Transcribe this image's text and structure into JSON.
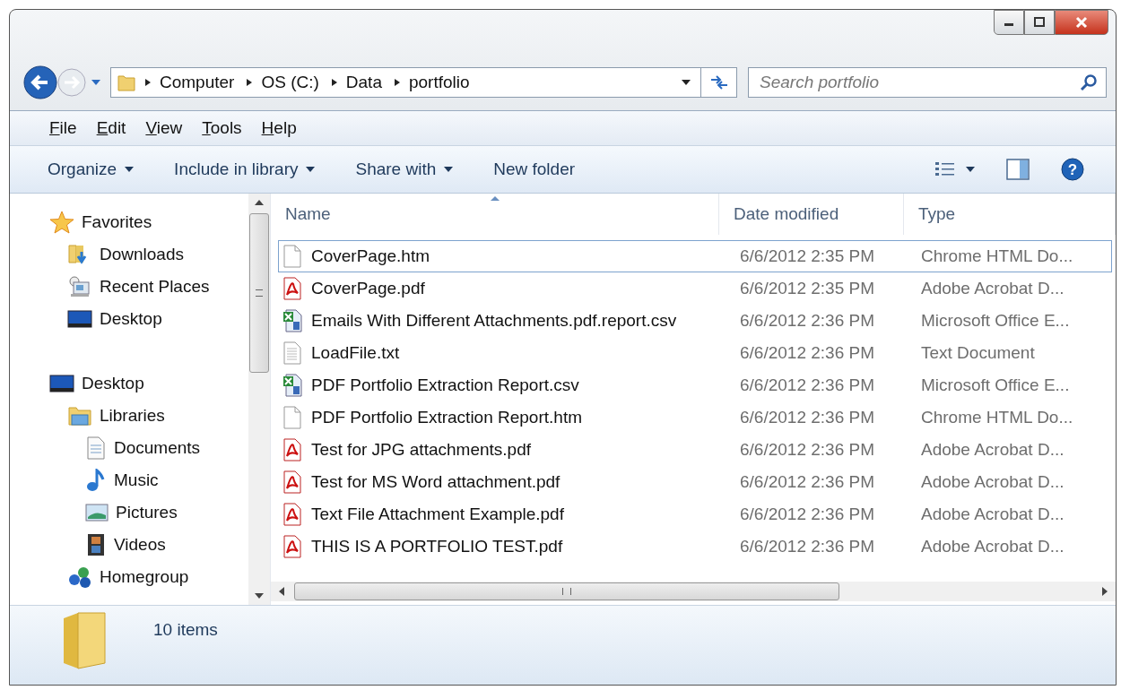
{
  "address_bar": {
    "crumbs": [
      "Computer",
      "OS (C:)",
      "Data",
      "portfolio"
    ]
  },
  "search": {
    "placeholder": "Search portfolio"
  },
  "menu_bar": [
    "File",
    "Edit",
    "View",
    "Tools",
    "Help"
  ],
  "command_bar": [
    {
      "label": "Organize",
      "dropdown": true
    },
    {
      "label": "Include in library",
      "dropdown": true
    },
    {
      "label": "Share with",
      "dropdown": true
    },
    {
      "label": "New folder",
      "dropdown": false
    }
  ],
  "sidebar": {
    "sections": [
      {
        "label": "Favorites",
        "kind": "star",
        "children": [
          {
            "label": "Downloads",
            "kind": "downloads"
          },
          {
            "label": "Recent Places",
            "kind": "recent"
          },
          {
            "label": "Desktop",
            "kind": "desktop"
          }
        ]
      },
      {
        "label": "Desktop",
        "kind": "desktop",
        "children": [
          {
            "label": "Libraries",
            "kind": "libraries",
            "children": [
              {
                "label": "Documents",
                "kind": "documents"
              },
              {
                "label": "Music",
                "kind": "music"
              },
              {
                "label": "Pictures",
                "kind": "pictures"
              },
              {
                "label": "Videos",
                "kind": "videos"
              }
            ]
          },
          {
            "label": "Homegroup",
            "kind": "homegroup"
          }
        ]
      }
    ]
  },
  "table": {
    "columns": [
      {
        "label": "Name",
        "sorted": true
      },
      {
        "label": "Date modified",
        "sorted": false
      },
      {
        "label": "Type",
        "sorted": false
      }
    ],
    "rows": [
      {
        "name": "CoverPage.htm",
        "kind": "htm",
        "date": "6/6/2012 2:35 PM",
        "type": "Chrome HTML Do...",
        "focused": true
      },
      {
        "name": "CoverPage.pdf",
        "kind": "pdf",
        "date": "6/6/2012 2:35 PM",
        "type": "Adobe Acrobat D...",
        "focused": false
      },
      {
        "name": "Emails With Different Attachments.pdf.report.csv",
        "kind": "csv",
        "date": "6/6/2012 2:36 PM",
        "type": "Microsoft Office E...",
        "focused": false
      },
      {
        "name": "LoadFile.txt",
        "kind": "txt",
        "date": "6/6/2012 2:36 PM",
        "type": "Text Document",
        "focused": false
      },
      {
        "name": "PDF Portfolio Extraction Report.csv",
        "kind": "csv",
        "date": "6/6/2012 2:36 PM",
        "type": "Microsoft Office E...",
        "focused": false
      },
      {
        "name": "PDF Portfolio Extraction Report.htm",
        "kind": "htm",
        "date": "6/6/2012 2:36 PM",
        "type": "Chrome HTML Do...",
        "focused": false
      },
      {
        "name": "Test for JPG attachments.pdf",
        "kind": "pdf",
        "date": "6/6/2012 2:36 PM",
        "type": "Adobe Acrobat D...",
        "focused": false
      },
      {
        "name": "Test for MS Word attachment.pdf",
        "kind": "pdf",
        "date": "6/6/2012 2:36 PM",
        "type": "Adobe Acrobat D...",
        "focused": false
      },
      {
        "name": "Text File Attachment Example.pdf",
        "kind": "pdf",
        "date": "6/6/2012 2:36 PM",
        "type": "Adobe Acrobat D...",
        "focused": false
      },
      {
        "name": "THIS IS A PORTFOLIO TEST.pdf",
        "kind": "pdf",
        "date": "6/6/2012 2:36 PM",
        "type": "Adobe Acrobat D...",
        "focused": false
      }
    ]
  },
  "help_button": {
    "glyph": "?"
  },
  "details_pane": {
    "count": "10 items"
  }
}
